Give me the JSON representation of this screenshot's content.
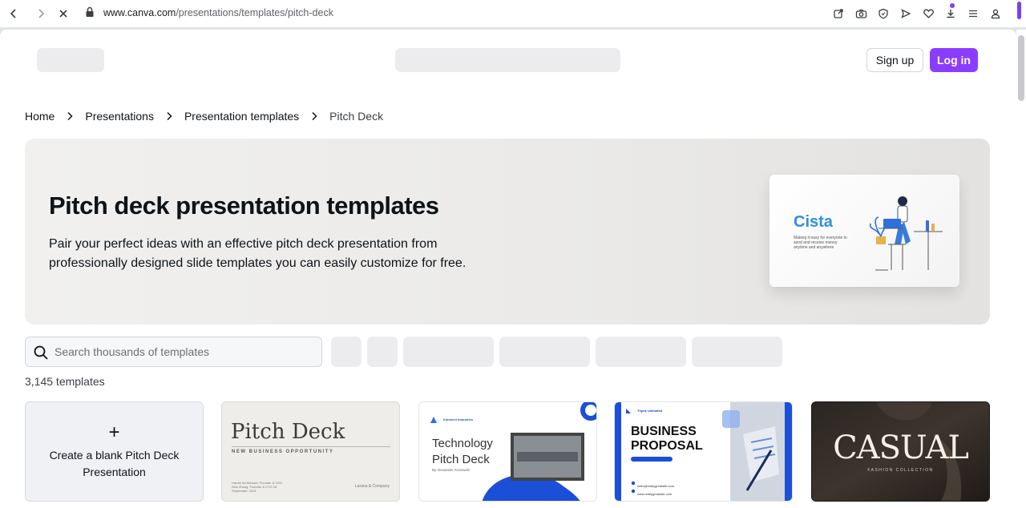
{
  "browser": {
    "url_host": "www.canva.com",
    "url_path": "/presentations/templates/pitch-deck"
  },
  "header": {
    "signup_label": "Sign up",
    "login_label": "Log in"
  },
  "breadcrumb": {
    "items": [
      "Home",
      "Presentations",
      "Presentation templates"
    ],
    "current": "Pitch Deck"
  },
  "hero": {
    "title": "Pitch deck presentation templates",
    "description": "Pair your perfect ideas with an effective pitch deck presentation from professionally designed slide templates you can easily customize for free.",
    "preview_brand": "Cista",
    "preview_tagline": "Making it easy for everyone to send and receive money anytime and anywhere"
  },
  "search": {
    "placeholder": "Search thousands of templates"
  },
  "results": {
    "count_label": "3,145 templates"
  },
  "blank_card": {
    "plus": "+",
    "label": "Create a blank Pitch Deck Presentation"
  },
  "templates": [
    {
      "title": "Pitch Deck",
      "subtitle": "NEW BUSINESS OPPORTUNITY",
      "details": "Harriet da Michael, Founder & CEO Nick Zhang, Founder & CTO 18 September, 2024",
      "logo": "Larana & Company"
    },
    {
      "company": "Kimmeni Industries",
      "title_line1": "Technology",
      "title_line2": "Pitch Deck",
      "author": "By Alexander Aronowitz"
    },
    {
      "company": "Thynk Unlimited",
      "title_line1": "BUSINESS",
      "title_line2": "PROPOSAL",
      "email": "hello@reallygreatsite.com",
      "site": "www.reallygreatsite.com"
    },
    {
      "title": "CASUAL",
      "subtitle": "FASHION COLLECTION"
    }
  ],
  "colors": {
    "brand_purple": "#8b3dff",
    "hero_bg": "#ebeae8",
    "accent_blue": "#1b4fd8"
  }
}
